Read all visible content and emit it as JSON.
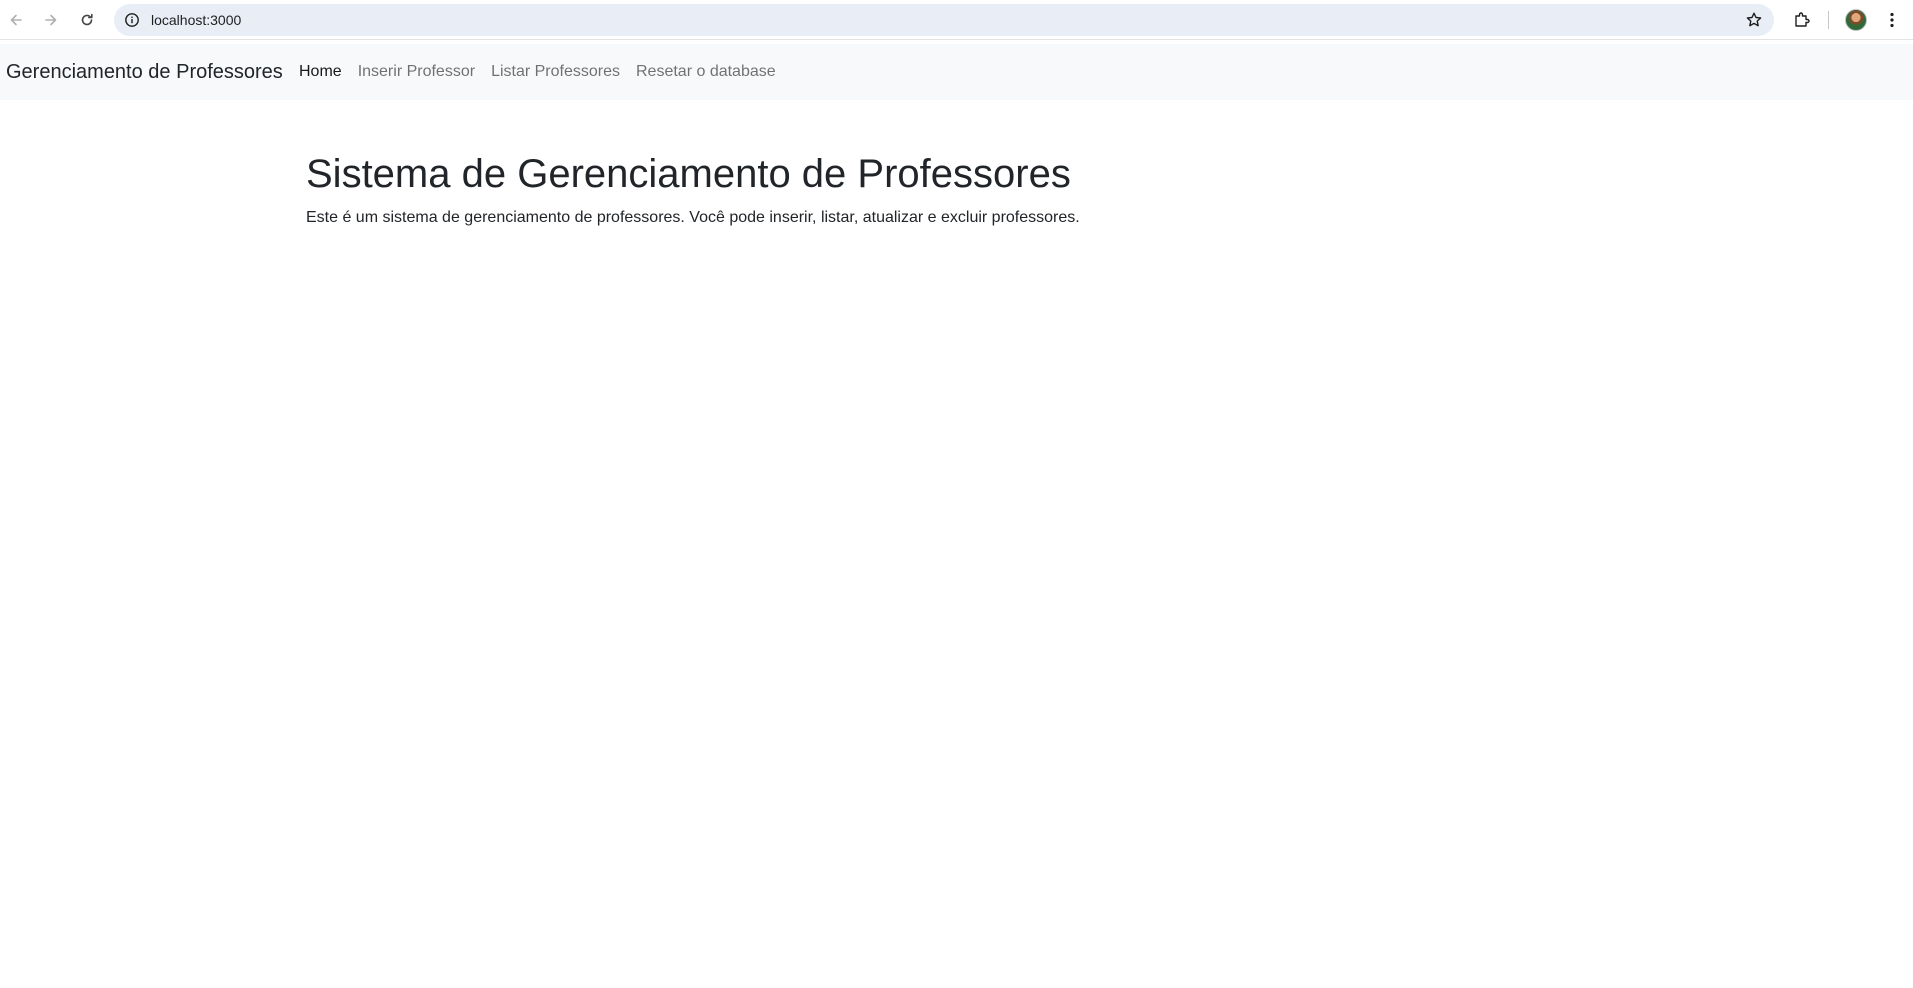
{
  "browser": {
    "url": "localhost:3000",
    "icons": [
      "back-icon",
      "forward-icon",
      "reload-icon",
      "site-info-icon",
      "bookmark-star-icon",
      "extensions-icon",
      "profile-avatar",
      "more-menu-icon"
    ]
  },
  "navbar": {
    "brand": "Gerenciamento de Professores",
    "links": [
      {
        "label": "Home",
        "active": true
      },
      {
        "label": "Inserir Professor",
        "active": false
      },
      {
        "label": "Listar Professores",
        "active": false
      },
      {
        "label": "Resetar o database",
        "active": false
      }
    ]
  },
  "main": {
    "title": "Sistema de Gerenciamento de Professores",
    "description": "Este é um sistema de gerenciamento de professores. Você pode inserir, listar, atualizar e excluir professores."
  },
  "colors": {
    "navbar_bg": "#f8f9fa",
    "text_primary": "#212529",
    "omnibox_bg": "#e9edf6"
  }
}
